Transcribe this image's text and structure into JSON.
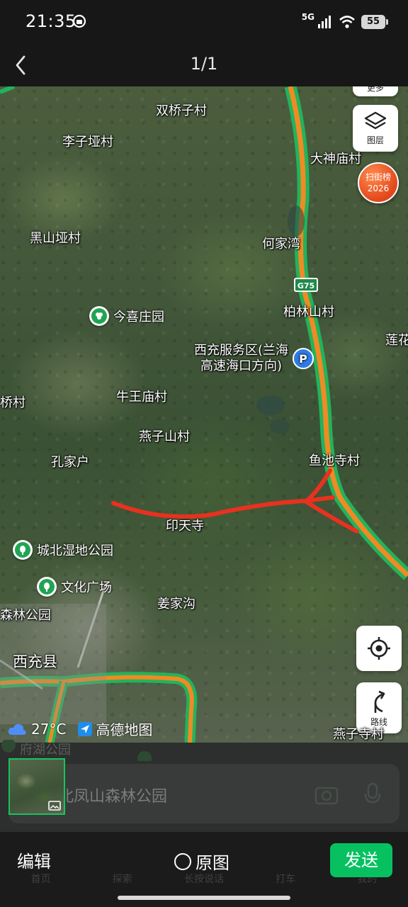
{
  "status_bar": {
    "time": "21:35",
    "network": "5G",
    "battery": "55"
  },
  "header": {
    "counter": "1/1"
  },
  "map": {
    "labels": {
      "shuangqiaozi": "双桥子村",
      "lizi": "李子垭村",
      "dashenmiao": "大神庙村",
      "heishan": "黑山垭村",
      "hejiawan": "何家湾",
      "bailinshan": "柏林山村",
      "lianhua": "莲花",
      "service_area": "西充服务区(兰海\n高速海口方向)",
      "qiao_left": "桥村",
      "niuwangmiao": "牛王庙村",
      "yanzishan": "燕子山村",
      "kongjiahu": "孔家户",
      "yuchisi": "鱼池寺村",
      "yintiansi": "印天寺",
      "jiangjiagou": "姜家沟",
      "senlin_park": "森林公园",
      "xichong": "西充县",
      "yanzisi": "燕子寺村",
      "bottom_poi": "府湖公园"
    },
    "pois": {
      "jinxi": "今喜庄园",
      "chengbei": "城北湿地公园",
      "wenhua": "文化广场"
    },
    "road_shield": "G75",
    "controls": {
      "more": "更多",
      "layers": "图层",
      "route": "路线"
    },
    "badge": {
      "line1": "扫街榜",
      "line2": "2026"
    },
    "weather": {
      "temp": "27°C",
      "brand": "高德地图"
    }
  },
  "search": {
    "placeholder": "北凤山森林公园"
  },
  "dim_tabs": [
    "首页",
    "探索",
    "长按说话",
    "打车",
    "我的"
  ],
  "bottom_bar": {
    "edit": "编辑",
    "original": "原图",
    "send": "发送"
  },
  "colors": {
    "highway_green": "#22b35d",
    "highway_orange": "#f08a24",
    "annotation_red": "#e8311f",
    "send_green": "#07c160"
  }
}
